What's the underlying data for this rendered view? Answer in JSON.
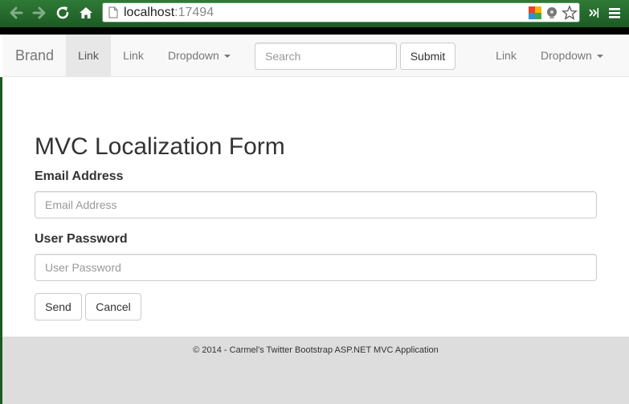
{
  "browser": {
    "url_host": "localhost",
    "url_port": ":17494"
  },
  "navbar": {
    "brand": "Brand",
    "items": [
      {
        "label": "Link",
        "active": true
      },
      {
        "label": "Link",
        "active": false
      },
      {
        "label": "Dropdown",
        "dropdown": true
      }
    ],
    "search_placeholder": "Search",
    "submit_label": "Submit",
    "right_items": [
      {
        "label": "Link"
      },
      {
        "label": "Dropdown",
        "dropdown": true
      }
    ]
  },
  "form": {
    "title": "MVC Localization Form",
    "email_label": "Email Address",
    "email_placeholder": "Email Address",
    "password_label": "User Password",
    "password_placeholder": "User Password",
    "send_label": "Send",
    "cancel_label": "Cancel"
  },
  "footer": {
    "text": "© 2014 - Carmel's Twitter Bootstrap ASP.NET MVC Application"
  },
  "colors": {
    "chrome_green": "#1c5a23",
    "navbar_bg": "#f8f8f8",
    "active_tab_bg": "#e7e7e7",
    "footer_bg": "#dddddd"
  },
  "icons": [
    "back-arrow-icon",
    "forward-arrow-icon",
    "reload-icon",
    "home-icon",
    "page-icon",
    "extension-icon",
    "lightbulb-icon",
    "star-icon",
    "overflow-chevron-icon",
    "menu-icon"
  ]
}
